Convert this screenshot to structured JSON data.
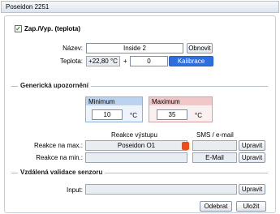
{
  "window": {
    "title": "Poseidon 2251"
  },
  "sensor": {
    "enable_label": "Zap./Vyp. (teplota)",
    "enabled": true,
    "name_label": "Název:",
    "name_value": "Inside 2",
    "refresh_button": "Obnovit",
    "temp_label": "Teplota:",
    "temp_reading": "+22,80 °C",
    "plus": "+",
    "offset_value": "0",
    "calibrate_button": "Kalibrace"
  },
  "generic_alerts": {
    "section_title": "Generická upozornění",
    "minimum": {
      "label": "Minimum",
      "value": "10",
      "unit": "°C"
    },
    "maximum": {
      "label": "Maximum",
      "value": "35",
      "unit": "°C"
    }
  },
  "reactions": {
    "col_output": "Reakce výstupu",
    "col_sms": "SMS / e-mail",
    "max": {
      "label": "Reakce na max.:",
      "output": "Poseidon O1",
      "sms": "",
      "edit": "Upravit"
    },
    "min": {
      "label": "Reakce na min.:",
      "output": "",
      "sms": "E-Mail",
      "edit": "Upravit"
    }
  },
  "remote_validation": {
    "section_title": "Vzdálená validace senzoru",
    "input_label": "Input:",
    "input_value": "",
    "edit": "Upravit"
  },
  "footer": {
    "remove_button": "Odebrat",
    "save_button": "Uložit"
  },
  "colors": {
    "accent_blue": "#2f6fdd",
    "min_header": "#bcd3ef",
    "max_header": "#f2c7c7",
    "alert_icon": "#e94e1b"
  }
}
